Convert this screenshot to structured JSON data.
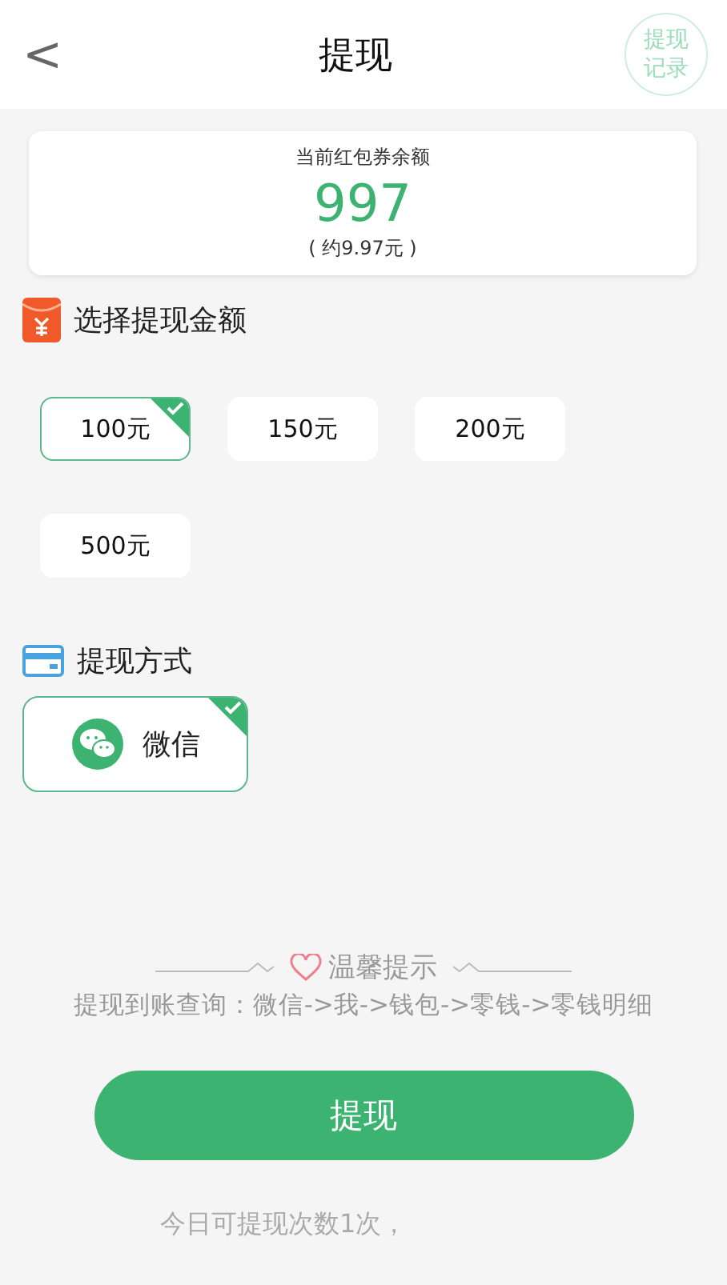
{
  "header": {
    "back": "<",
    "title": "提现",
    "record_button": "提现记录"
  },
  "balance": {
    "label": "当前红包券余额",
    "value": "997",
    "approx": "( 约9.97元 )"
  },
  "amount_section": {
    "title": "选择提现金额",
    "options": [
      {
        "label": "100元",
        "selected": true
      },
      {
        "label": "150元",
        "selected": false
      },
      {
        "label": "200元",
        "selected": false
      },
      {
        "label": "500元",
        "selected": false
      }
    ]
  },
  "method_section": {
    "title": "提现方式",
    "methods": [
      {
        "label": "微信",
        "selected": true
      }
    ]
  },
  "tip": {
    "title": "温馨提示",
    "text": "提现到账查询：微信->我->钱包->零钱->零钱明细"
  },
  "submit": "提现",
  "footer_note": "今日可提现次数1次，"
}
